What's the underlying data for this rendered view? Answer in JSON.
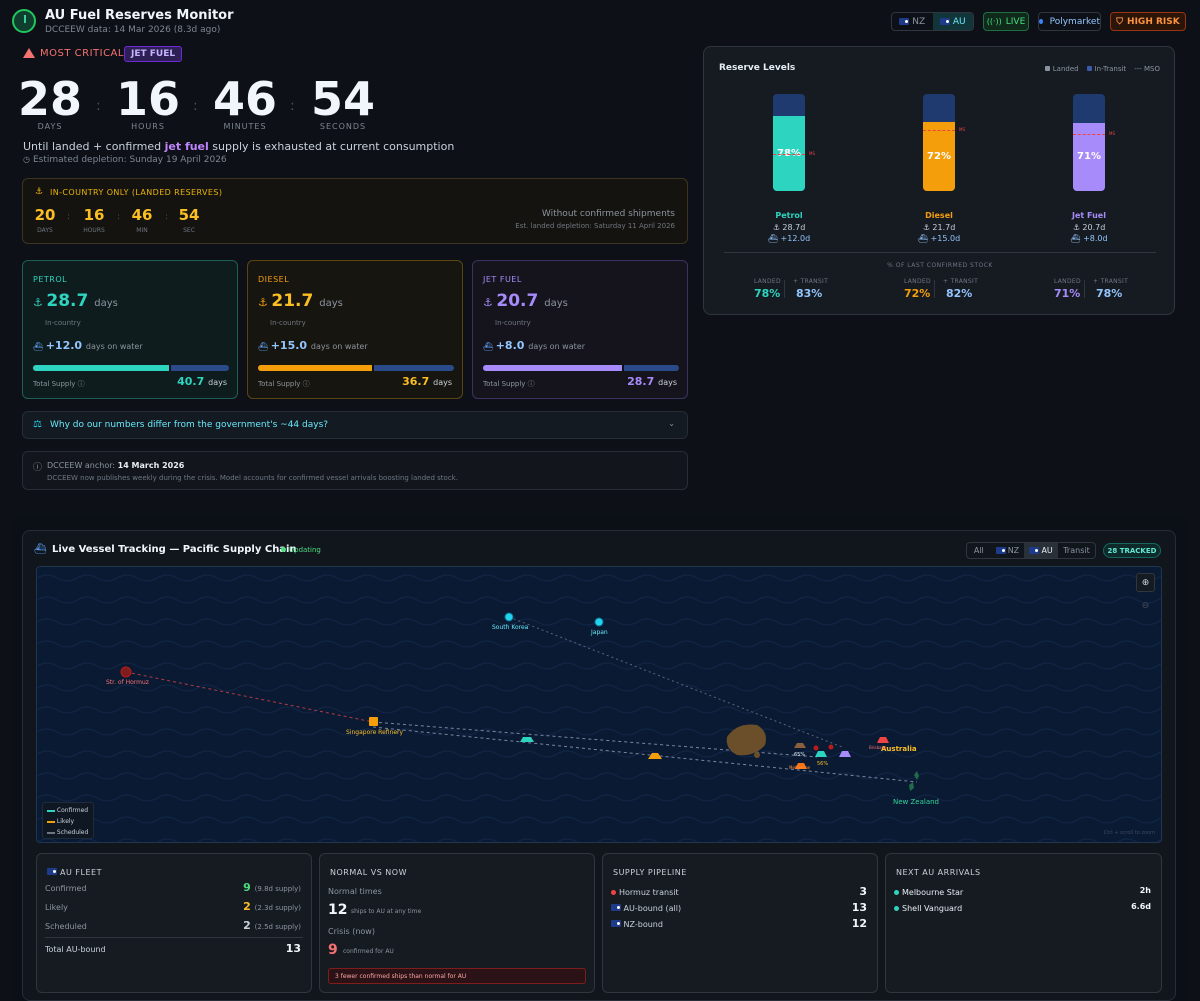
{
  "header": {
    "title": "AU Fuel Reserves Monitor",
    "subtitle": "DCCEEW data: 14 Mar 2026 (8.3d ago)",
    "region_toggle": [
      "NZ",
      "AU"
    ],
    "live_label": "LIVE",
    "polymarket_label": "Polymarket",
    "risk_label": "HIGH RISK"
  },
  "countdown": {
    "most_critical_label": "MOST CRITICAL:",
    "most_critical_fuel": "JET FUEL",
    "days": "28",
    "hours": "16",
    "minutes": "46",
    "seconds": "54",
    "labels": [
      "DAYS",
      "HOURS",
      "MINUTES",
      "SECONDS"
    ],
    "line_pre": "Until landed + confirmed ",
    "line_fuel": "jet fuel",
    "line_post": " supply is exhausted at current consumption",
    "depletion": "Estimated depletion: Sunday 19 April 2026"
  },
  "in_country": {
    "title": "IN-COUNTRY ONLY (LANDED RESERVES)",
    "days": "20",
    "hours": "16",
    "min": "46",
    "sec": "54",
    "labels": [
      "DAYS",
      "HOURS",
      "MIN",
      "SEC"
    ],
    "note": "Without confirmed shipments",
    "note_sub": "Est. landed depletion: Saturday 11 April 2026"
  },
  "fuels": [
    {
      "name": "PETROL",
      "days": "28.7",
      "unit": "days",
      "sub": "In-country",
      "water": "+12.0",
      "water_unit": "days on water",
      "total_label": "Total Supply",
      "total": "40.7",
      "total_unit": "days",
      "landed_share": 0.705,
      "color": "#2dd4bf"
    },
    {
      "name": "DIESEL",
      "days": "21.7",
      "unit": "days",
      "sub": "In-country",
      "water": "+15.0",
      "water_unit": "days on water",
      "total_label": "Total Supply",
      "total": "36.7",
      "total_unit": "days",
      "landed_share": 0.591,
      "color": "#f59e0b"
    },
    {
      "name": "JET FUEL",
      "days": "20.7",
      "unit": "days",
      "sub": "In-country",
      "water": "+8.0",
      "water_unit": "days on water",
      "total_label": "Total Supply",
      "total": "28.7",
      "total_unit": "days",
      "landed_share": 0.721,
      "color": "#a78bfa"
    }
  ],
  "faq": {
    "question": "Why do our numbers differ from the government's ~44 days?"
  },
  "anchor": {
    "label": "DCCEEW anchor:",
    "date": "14 March 2026",
    "text": "DCCEEW now publishes weekly during the crisis. Model accounts for confirmed vessel arrivals boosting landed stock."
  },
  "reserve_levels": {
    "title": "Reserve Levels",
    "legend": [
      "Landed",
      "In-Transit",
      "MSO"
    ],
    "tanks": [
      {
        "name": "Petrol",
        "pct": "78%",
        "level": 0.78,
        "mso": 0.5,
        "days": "28.7d",
        "transit": "+12.0d",
        "color": "#2dd4bf"
      },
      {
        "name": "Diesel",
        "pct": "72%",
        "level": 0.72,
        "mso": 0.82,
        "days": "21.7d",
        "transit": "+15.0d",
        "color": "#f59e0b"
      },
      {
        "name": "Jet Fuel",
        "pct": "71%",
        "level": 0.71,
        "mso": 0.76,
        "days": "20.7d",
        "transit": "+8.0d",
        "color": "#a78bfa"
      }
    ],
    "mso_tag": "MS",
    "pct_title": "% OF LAST CONFIRMED STOCK",
    "landed_label": "LANDED",
    "transit_label": "+ TRANSIT",
    "pct": [
      {
        "landed": "78%",
        "transit": "83%"
      },
      {
        "landed": "72%",
        "transit": "82%"
      },
      {
        "landed": "71%",
        "transit": "78%"
      }
    ]
  },
  "tracking": {
    "title": "Live Vessel Tracking — Pacific Supply Chain",
    "status": "Updating",
    "filters": [
      "All",
      "NZ",
      "AU",
      "Transit"
    ],
    "tracked": "28 TRACKED",
    "map_labels": {
      "south_korea": "South Korea",
      "japan": "Japan",
      "hormuz": "Str. of Hormuz",
      "singapore": "Singapore Refinery",
      "australia": "Australia",
      "new_zealand": "New Zealand",
      "brisbane": "Brisbane",
      "melbourne": "Melbourne",
      "pct_a": "65%",
      "pct_b": "56%"
    },
    "legend": [
      "Confirmed",
      "Likely",
      "Scheduled"
    ],
    "zoom_hint": "Ctrl + scroll to zoom"
  },
  "fleet": {
    "title": "AU FLEET",
    "rows": [
      {
        "label": "Confirmed",
        "value": "9",
        "note": "(9.8d supply)"
      },
      {
        "label": "Likely",
        "value": "2",
        "note": "(2.3d supply)"
      },
      {
        "label": "Scheduled",
        "value": "2",
        "note": "(2.5d supply)"
      }
    ],
    "total_label": "Total AU-bound",
    "total": "13"
  },
  "normal": {
    "title": "NORMAL VS NOW",
    "normal_label": "Normal times",
    "normal_value": "12",
    "normal_note": "ships to AU at any time",
    "crisis_label": "Crisis (now)",
    "crisis_value": "9",
    "crisis_note": "confirmed for AU",
    "alert": "3 fewer confirmed ships than normal for AU"
  },
  "pipeline": {
    "title": "SUPPLY PIPELINE",
    "rows": [
      {
        "label": "Hormuz transit",
        "value": "3"
      },
      {
        "label": "AU-bound (all)",
        "value": "13"
      },
      {
        "label": "NZ-bound",
        "value": "12"
      }
    ]
  },
  "arrivals": {
    "title": "NEXT AU ARRIVALS",
    "rows": [
      {
        "label": "Melbourne Star",
        "value": "2h"
      },
      {
        "label": "Shell Vanguard",
        "value": "6.6d"
      }
    ]
  }
}
